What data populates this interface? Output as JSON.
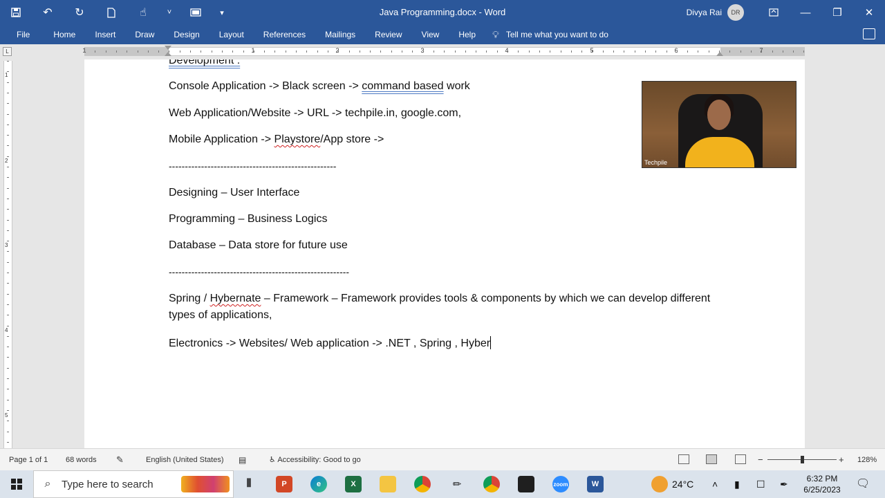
{
  "window": {
    "title": "Java Programming.docx  -  Word",
    "user_name": "Divya Rai",
    "user_initials": "DR"
  },
  "ribbon": {
    "tabs": [
      "File",
      "Home",
      "Insert",
      "Draw",
      "Design",
      "Layout",
      "References",
      "Mailings",
      "Review",
      "View",
      "Help"
    ],
    "tell_me": "Tell me what you want to do"
  },
  "ruler": {
    "numbers": [
      "1",
      "1",
      "2",
      "3",
      "4",
      "5",
      "6",
      "7"
    ],
    "vnumbers": [
      "1",
      "2",
      "3",
      "4",
      "5"
    ]
  },
  "document": {
    "line0": "Development :",
    "line1_a": "Console Application -> Black screen -> ",
    "line1_b": "command based",
    "line1_c": " work",
    "line2": "Web Application/Website -> URL -> techpile.in, google.com,",
    "line3_a": "Mobile Application -> ",
    "line3_b": "Playstore",
    "line3_c": "/App store ->",
    "sep1": "----------------------------------------------------",
    "line4": "Designing – User Interface",
    "line5": "Programming – Business Logics",
    "line6": "Database – Data store for future use",
    "sep2": "--------------------------------------------------------",
    "line7_a": "Spring / ",
    "line7_b": "Hybernate",
    "line7_c": " – Framework – Framework provides tools & components by which we can develop different types of applications,",
    "line8": "Electronics -> Websites/ Web application -> .NET , Spring , Hyber"
  },
  "webcam": {
    "label": "Techpile"
  },
  "status": {
    "page": "Page 1 of 1",
    "words": "68 words",
    "language": "English (United States)",
    "accessibility": "Accessibility: Good to go",
    "zoom": "128%"
  },
  "taskbar": {
    "search_placeholder": "Type here to search",
    "temperature": "24°C",
    "time": "6:32 PM",
    "date": "6/25/2023"
  }
}
